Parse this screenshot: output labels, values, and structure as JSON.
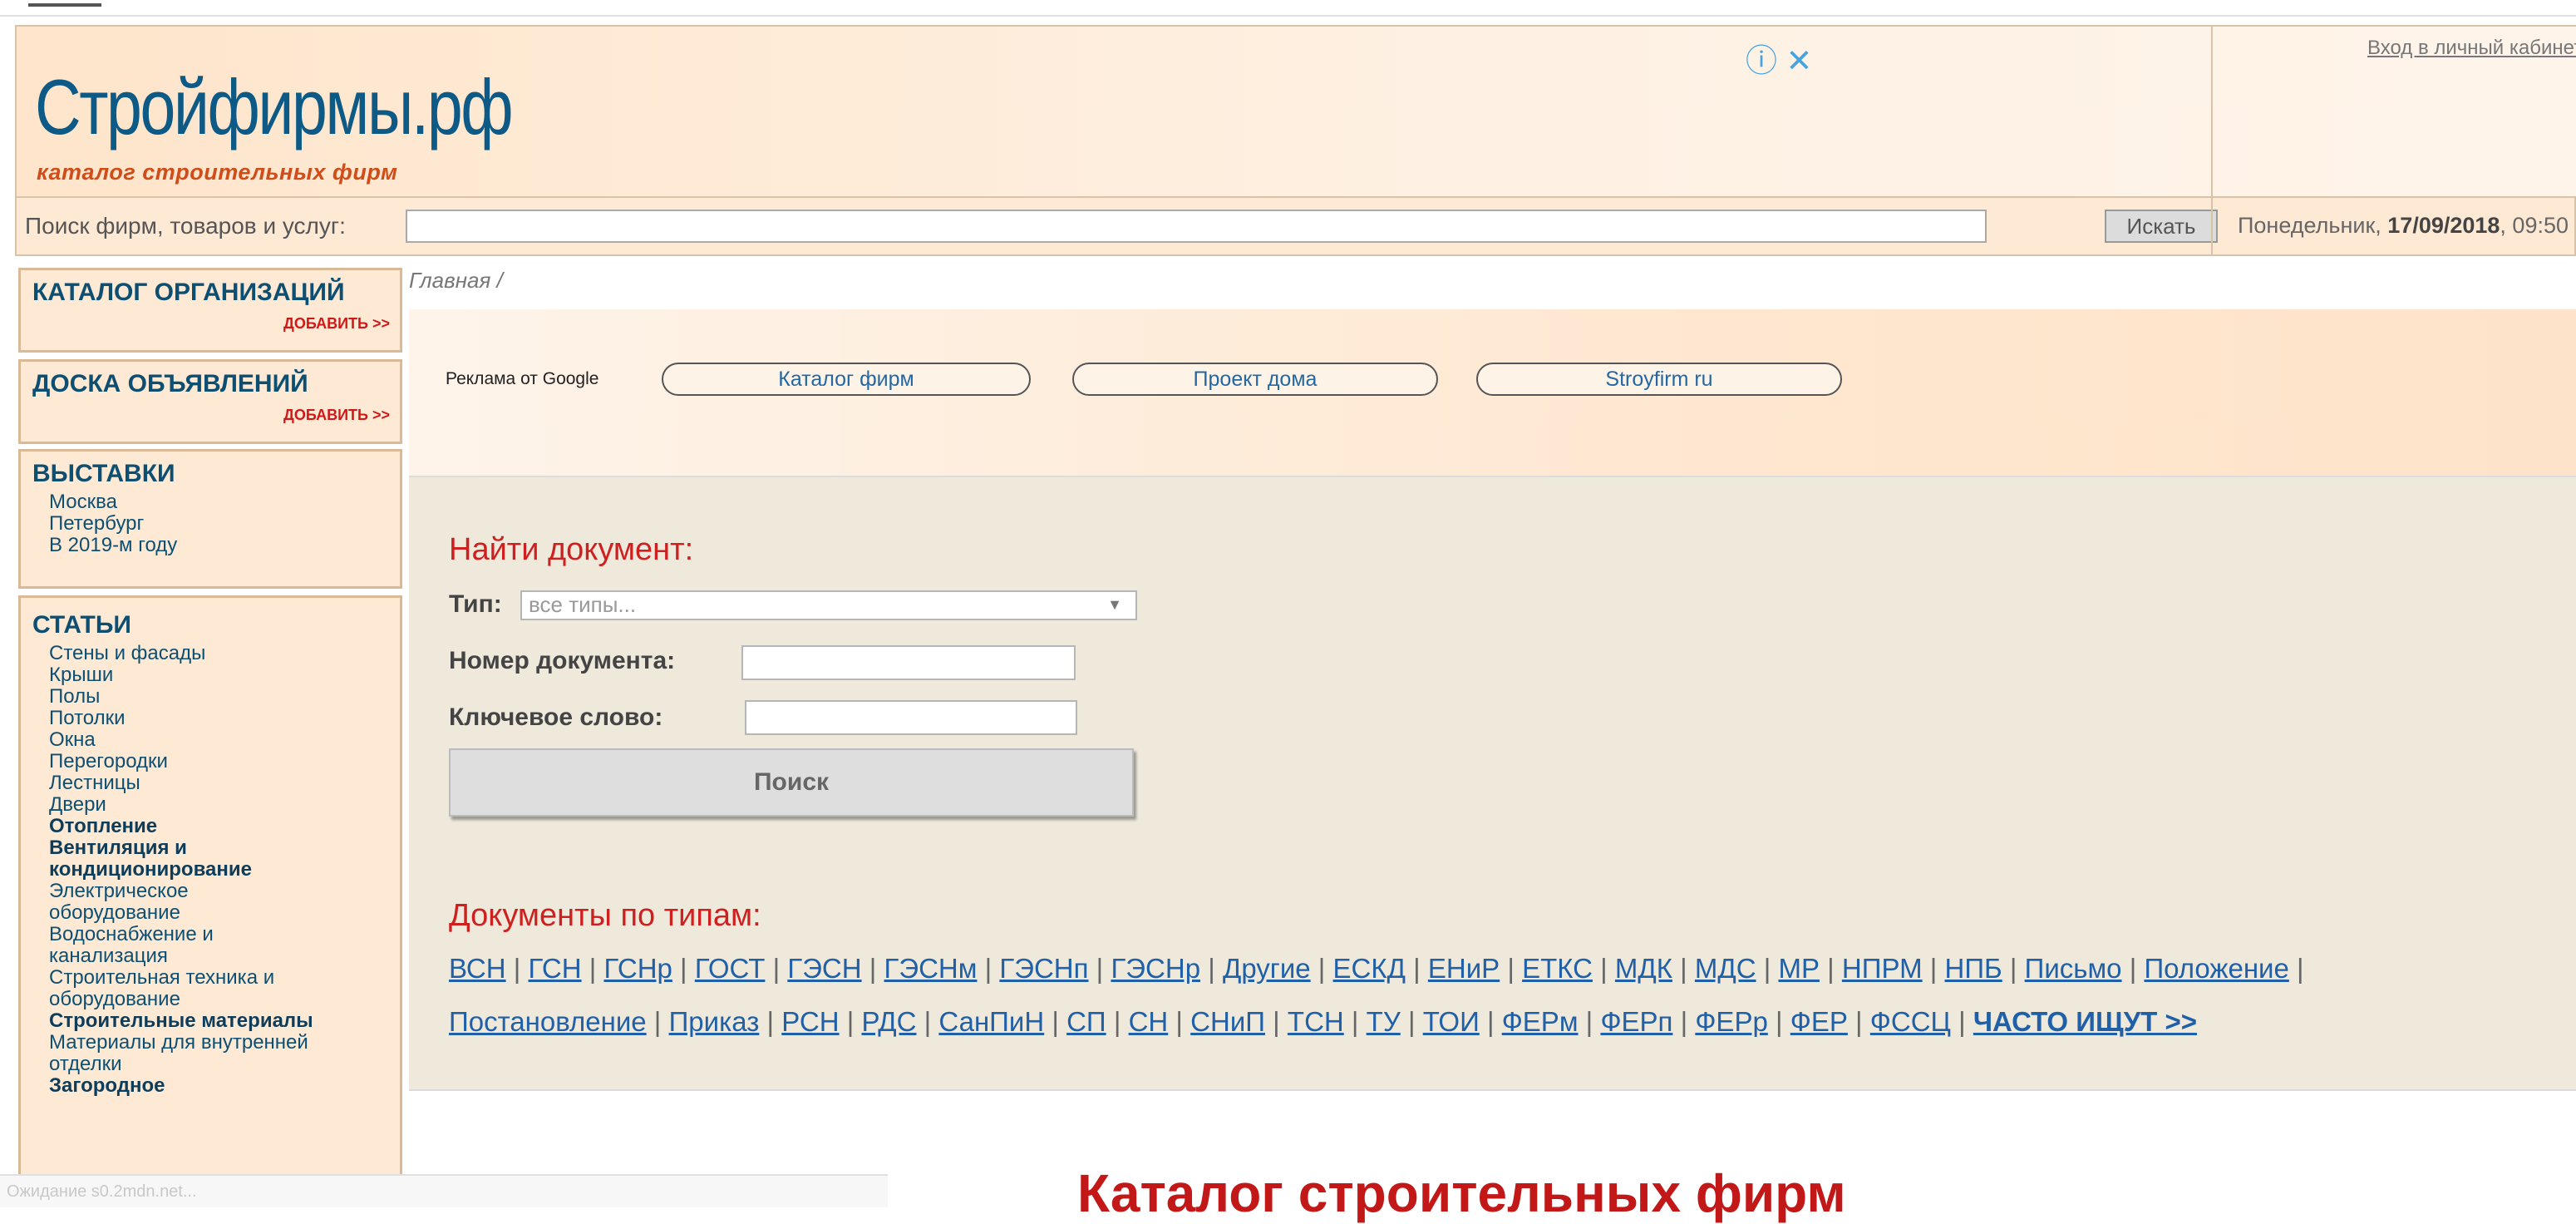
{
  "header": {
    "logo": "Стройфирмы.рф",
    "tagline": "каталог строительных фирм",
    "ad_controls": "ⓘ ✕",
    "login_link": "Вход в личный кабинет"
  },
  "search": {
    "label": "Поиск фирм, товаров и услуг:",
    "value": "",
    "button": "Искать",
    "date_prefix": "Понедельник,",
    "date_bold": "17/09/2018",
    "date_suffix": ", 09:50"
  },
  "sidebar": {
    "catalog": {
      "title": "КАТАЛОГ ОРГАНИЗАЦИЙ",
      "add": "ДОБАВИТЬ >>"
    },
    "board": {
      "title": "ДОСКА ОБЪЯВЛЕНИЙ",
      "add": "ДОБАВИТЬ >>"
    },
    "exhibitions": {
      "title": "ВЫСТАВКИ",
      "items": [
        "Москва",
        "Петербург",
        "В 2019-м году"
      ]
    },
    "articles": {
      "title": "СТАТЬИ",
      "items": [
        "Стены и фасады",
        "Крыши",
        "Полы",
        "Потолки",
        "Окна",
        "Перегородки",
        "Лестницы",
        "Двери",
        "Отопление",
        "Вентиляция и",
        "кондиционирование",
        "Электрическое",
        "оборудование",
        "Водоснабжение и",
        "канализация",
        "Строительная техника и",
        "оборудование",
        "Строительные материалы",
        "Материалы для внутренней",
        "отделки",
        "Загородное"
      ]
    }
  },
  "breadcrumb": {
    "home": "Главная",
    "sep": " /"
  },
  "ads": {
    "label": "Реклама от Google",
    "buttons": [
      "Каталог фирм",
      "Проект дома",
      "Stroyfirm ru"
    ]
  },
  "doc_search": {
    "title": "Найти документ:",
    "type_label": "Тип:",
    "type_value": "все типы...",
    "number_label": "Номер документа:",
    "keyword_label": "Ключевое слово:",
    "button": "Поиск"
  },
  "doc_types": {
    "title": "Документы по типам:",
    "row1": [
      "ВСН",
      "ГСН",
      "ГСНр",
      "ГОСТ",
      "ГЭСН",
      "ГЭСНм",
      "ГЭСНп",
      "ГЭСНр",
      "Другие",
      "ЕСКД",
      "ЕНиР",
      "ЕТКС",
      "МДК",
      "МДС",
      "МР",
      "НПРМ",
      "НПБ",
      "Письмо",
      "Положение"
    ],
    "row2": [
      "Постановление",
      "Приказ",
      "РСН",
      "РДС",
      "СанПиН",
      "СП",
      "СН",
      "СНиП",
      "ТСН",
      "ТУ",
      "ТОИ",
      "ФЕРм",
      "ФЕРп",
      "ФЕРр",
      "ФЕР",
      "ФССЦ"
    ],
    "often": "ЧАСТО ИЩУТ >>"
  },
  "catalog_title": "Каталог строительных фирм",
  "status_bar": "Ожидание s0.2mdn.net..."
}
